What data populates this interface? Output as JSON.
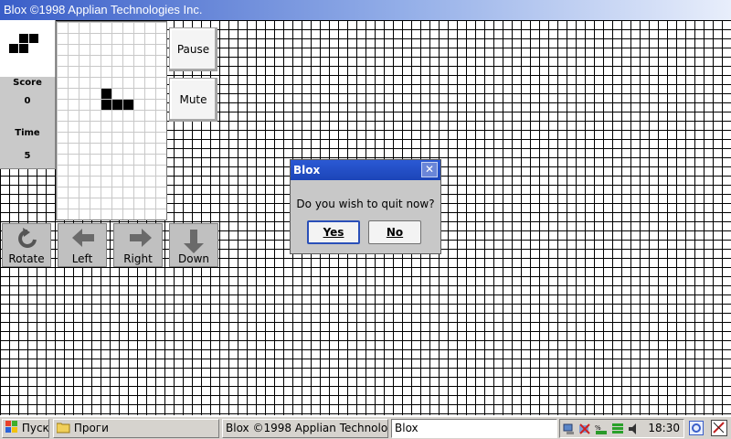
{
  "window": {
    "title": "Blox ©1998 Applian Technologies Inc."
  },
  "info": {
    "score_label": "Score",
    "score_value": "0",
    "time_label": "Time",
    "time_value": "5"
  },
  "side_buttons": {
    "pause": "Pause",
    "mute": "Mute"
  },
  "controls": {
    "rotate": "Rotate",
    "left": "Left",
    "right": "Right",
    "down": "Down"
  },
  "dialog": {
    "title": "Blox",
    "close": "✕",
    "message": "Do you wish to quit now?",
    "yes": "Yes",
    "no": "No"
  },
  "taskbar": {
    "start": "Пуск",
    "folder": "Проги",
    "task_blox": "Blox ©1998 Applian Technolo...",
    "task_input": "Blox",
    "clock": "18:30"
  },
  "colors": {
    "title_gradient_start": "#3a5ec8",
    "dialog_title": "#2b59d4",
    "panel_gray": "#c9c9c9",
    "taskbar": "#d6d3ce"
  }
}
